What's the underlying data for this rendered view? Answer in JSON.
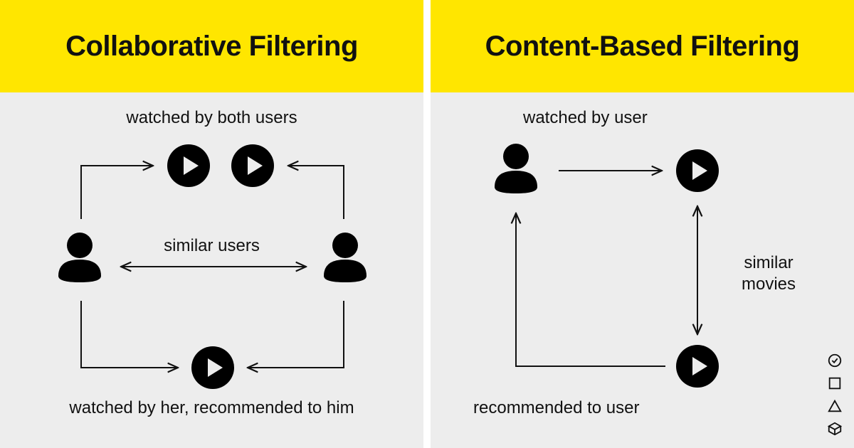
{
  "left": {
    "title": "Collaborative Filtering",
    "top_label": "watched by both users",
    "mid_label": "similar users",
    "bottom_label": "watched by her, recommended to him"
  },
  "right": {
    "title": "Content-Based Filtering",
    "top_label": "watched by user",
    "mid_label": "similar\nmovies",
    "bottom_label": "recommended to user"
  },
  "colors": {
    "accent": "#ffe600",
    "bg": "#ededed",
    "fg": "#111111"
  },
  "icons": {
    "user": "user-icon",
    "play": "play-icon",
    "side": [
      "check-circle-icon",
      "square-icon",
      "triangle-icon",
      "cube-icon"
    ]
  }
}
